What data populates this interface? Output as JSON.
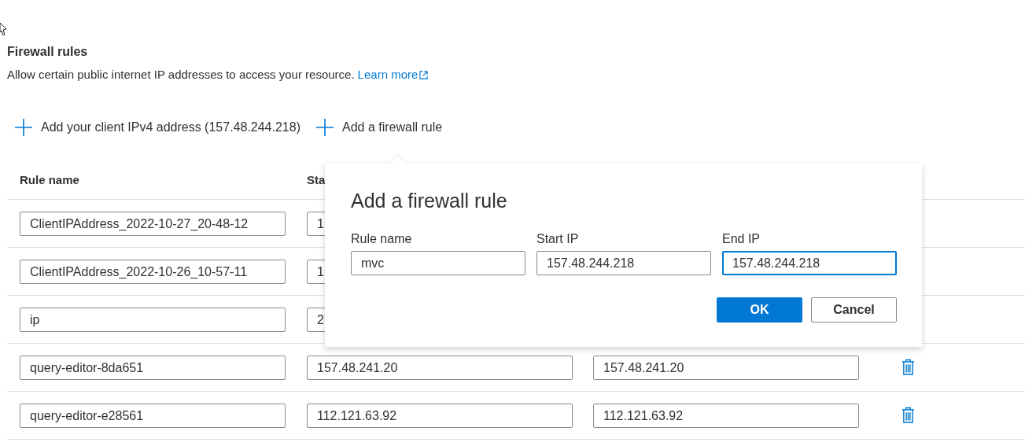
{
  "section": {
    "title": "Firewall rules",
    "description": "Allow certain public internet IP addresses to access your resource.",
    "link": "Learn more"
  },
  "toolbar": [
    {
      "label": "Add your client IPv4 address (157.48.244.218)"
    },
    {
      "label": "Add a firewall rule"
    }
  ],
  "table": {
    "columns": [
      "Rule name",
      "Sta"
    ],
    "rows": [
      {
        "rule_name": "ClientIPAddress_2022-10-27_20-48-12",
        "start_ip": "1"
      },
      {
        "rule_name": "ClientIPAddress_2022-10-26_10-57-11",
        "start_ip": "1"
      },
      {
        "rule_name": "ip",
        "start_ip": "2"
      },
      {
        "rule_name": "query-editor-8da651",
        "start_ip": "157.48.241.20",
        "end_ip": "157.48.241.20",
        "delete": true
      },
      {
        "rule_name": "query-editor-e28561",
        "start_ip": "112.121.63.92",
        "end_ip": "112.121.63.92",
        "delete": true
      }
    ]
  },
  "callout": {
    "title": "Add a firewall rule",
    "fields": [
      {
        "label": "Rule name",
        "value": "mvc",
        "focused": false
      },
      {
        "label": "Start IP",
        "value": "157.48.244.218",
        "focused": false
      },
      {
        "label": "End IP",
        "value": "157.48.244.218",
        "focused": true
      }
    ],
    "buttons": [
      {
        "label": "OK",
        "kind": "primary"
      },
      {
        "label": "Cancel",
        "kind": "default"
      }
    ]
  }
}
